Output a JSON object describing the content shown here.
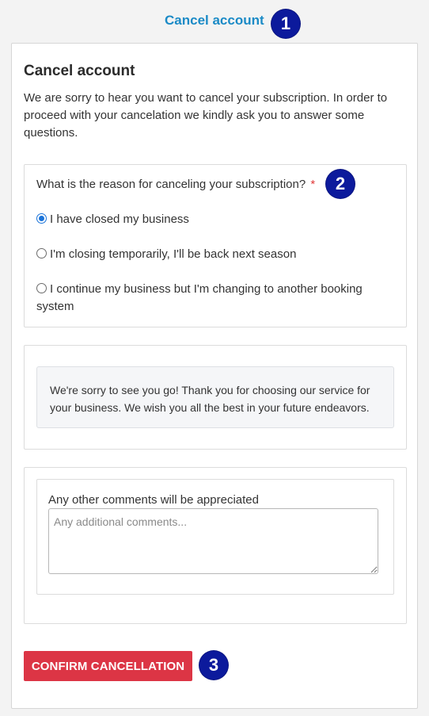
{
  "header": {
    "link_label": "Cancel account"
  },
  "annotations": {
    "badge_1": "1",
    "badge_2": "2",
    "badge_3": "3"
  },
  "card": {
    "title": "Cancel account",
    "intro": "We are sorry to hear you want to cancel your subscription. In order to proceed with your cancelation we kindly ask you to answer some questions."
  },
  "question": {
    "label": "What is the reason for canceling your subscription?",
    "required_marker": "*",
    "options": [
      {
        "label": "I have closed my business",
        "checked": true
      },
      {
        "label": "I'm closing temporarily, I'll be back next season",
        "checked": false
      },
      {
        "label": "I continue my business but I'm changing to another booking system",
        "checked": false
      }
    ]
  },
  "message": {
    "text": "We're sorry to see you go! Thank you for choosing our service for your business. We wish you all the best in your future endeavors."
  },
  "comments": {
    "label": "Any other comments will be appreciated",
    "value": "",
    "placeholder": "Any additional comments..."
  },
  "actions": {
    "confirm_label": "CONFIRM CANCELLATION"
  },
  "colors": {
    "page_background": "#f3f3f3",
    "link": "#1a8ac6",
    "badge": "#0c1a9c",
    "danger_button": "#dc3545",
    "required": "#e03a3a",
    "radio_checked": "#1a73d9"
  }
}
